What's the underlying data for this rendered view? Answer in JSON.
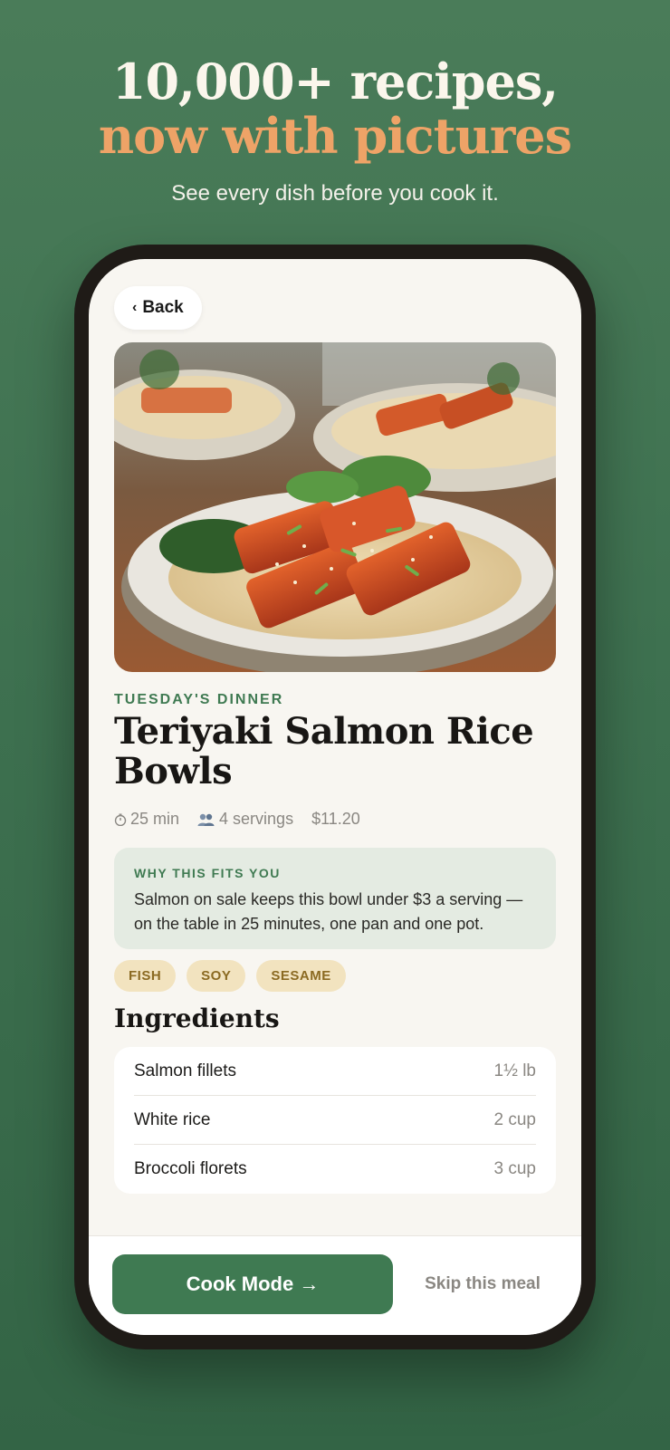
{
  "promo": {
    "headline_line1": "10,000+ recipes,",
    "headline_line2": "now with pictures",
    "subhead": "See every dish before you cook it."
  },
  "nav": {
    "back_label": "Back",
    "back_icon": "chevron-left-icon"
  },
  "hero": {
    "image_alt": "Teriyaki salmon over rice in a bowl"
  },
  "recipe": {
    "eyebrow": "TUESDAY'S DINNER",
    "title": "Teriyaki Salmon Rice Bowls",
    "time": "25 min",
    "servings": "4 servings",
    "cost": "$11.20"
  },
  "fit": {
    "label": "WHY THIS FITS YOU",
    "text": "Salmon on sale keeps this bowl under $3 a serving — on the table in 25 minutes, one pan and one pot."
  },
  "tags": [
    "FISH",
    "SOY",
    "SESAME"
  ],
  "ingredients": {
    "heading": "Ingredients",
    "items": [
      {
        "name": "Salmon fillets",
        "qty": "1½ lb"
      },
      {
        "name": "White rice",
        "qty": "2 cup"
      },
      {
        "name": "Broccoli florets",
        "qty": "3 cup"
      }
    ]
  },
  "actions": {
    "cook_mode": "Cook Mode →",
    "skip": "Skip this meal"
  },
  "colors": {
    "brand_green": "#3f7a52",
    "accent_orange": "#eea367",
    "tag_bg": "#f2e3bf",
    "fit_bg": "#e4ebe2"
  }
}
